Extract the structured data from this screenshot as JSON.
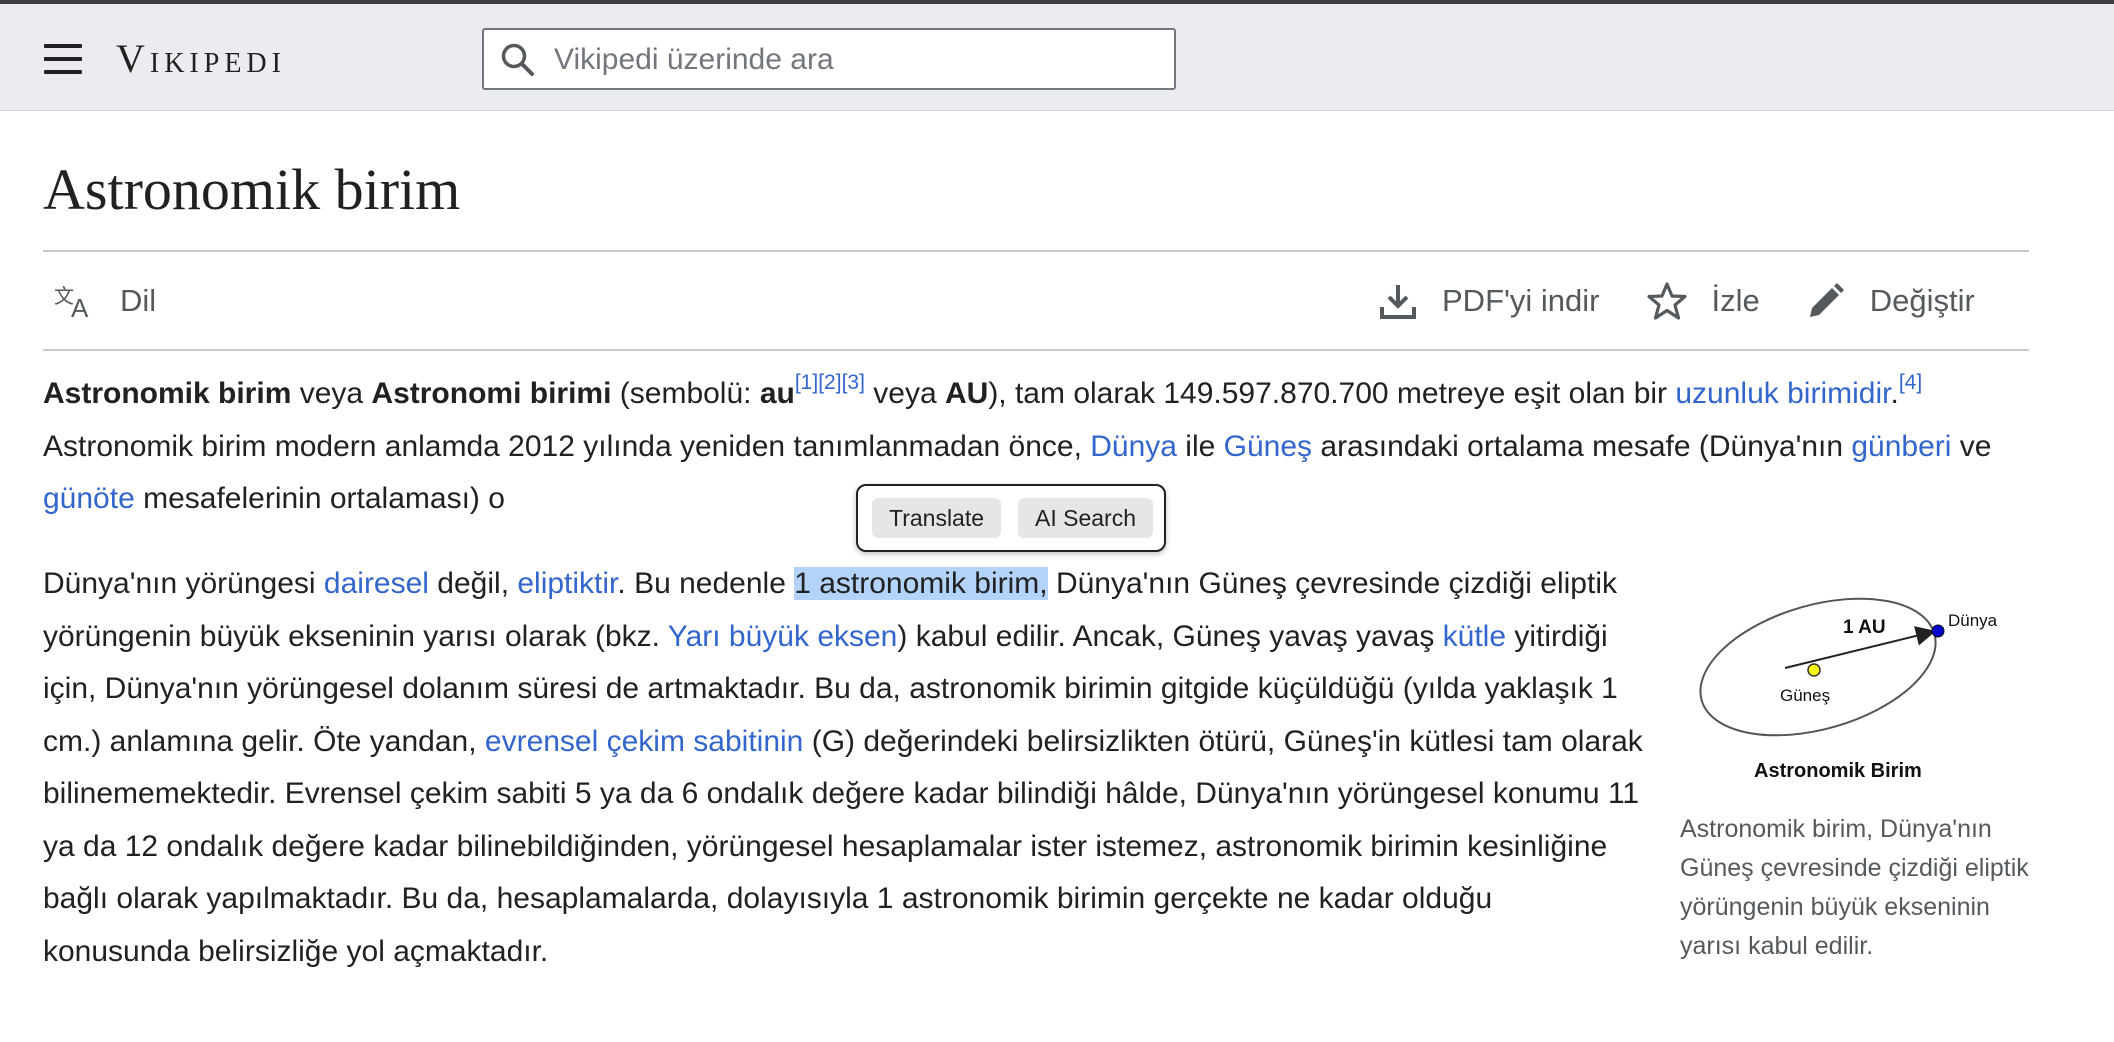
{
  "header": {
    "logo": "Vikipedi",
    "search_placeholder": "Vikipedi üzerinde ara"
  },
  "page": {
    "title": "Astronomik birim"
  },
  "toolbar": {
    "language_label": "Dil",
    "pdf_label": "PDF'yi indir",
    "watch_label": "İzle",
    "edit_label": "Değiştir"
  },
  "para1": {
    "b1": "Astronomik birim",
    "t1": " veya ",
    "b2": "Astronomi birimi",
    "t2": " (sembolü: ",
    "b3": "au",
    "r1": "[1]",
    "r2": "[2]",
    "r3": "[3]",
    "t3": " veya ",
    "b4": "AU",
    "t4": "), tam olarak 149.597.870.700 metreye eşit olan bir ",
    "l1": "uzunluk birimidir",
    "t5": ".",
    "r4": "[4]",
    "t6": " Astronomik birim modern anlamda 2012 yılında yeniden tanımlanmadan önce, ",
    "l2": "Dünya",
    "t7": " ile ",
    "l3": "Güneş",
    "t8": " arasındaki ortalama mesafe (Dünya'nın ",
    "l4": "günberi",
    "t9": " ve ",
    "l5": "günöte",
    "t10": " mesafelerinin ortalaması) o"
  },
  "para2": {
    "t1": "Dünya'nın yörüngesi ",
    "l1": "dairesel",
    "t2": " değil, ",
    "l2": "eliptiktir",
    "t3": ". Bu nedenle ",
    "hl": "1 astronomik birim,",
    "t4": " Dünya'nın Güneş çevresinde çizdiği eliptik yörüngenin büyük ekseninin yarısı olarak (bkz. ",
    "l3": "Yarı büyük eksen",
    "t5": ") kabul edilir. Ancak, Güneş yavaş yavaş ",
    "l4": "kütle",
    "t6": " yitirdiği için, Dünya'nın yörüngesel dolanım süresi de artmaktadır. Bu da, astronomik birimin gitgide küçüldüğü (yılda yaklaşık 1 cm.) anlamına gelir. Öte yandan, ",
    "l5": "evrensel çekim sabitinin",
    "t7": " (G) değerindeki belirsizlikten ötürü, Güneş'in kütlesi tam olarak bilinememektedir. Evrensel çekim sabiti 5 ya da 6 ondalık değere kadar bilindiği hâlde, Dünya'nın yörüngesel konumu 11 ya da 12 ondalık değere kadar bilinebildiğinden, yörüngesel hesaplamalar ister istemez, astronomik birimin kesinliğine bağlı olarak yapılmaktadır. Bu da, hesaplamalarda, dolayısıyla 1 astronomik birimin gerçekte ne kadar olduğu konusunda belirsizliğe yol açmaktadır."
  },
  "selection_popup": {
    "translate": "Translate",
    "ai_search": "AI Search"
  },
  "figure": {
    "label_au": "1 AU",
    "label_earth": "Dünya",
    "label_sun": "Güneş",
    "title": "Astronomik Birim",
    "caption": "Astronomik birim, Dünya'nın Güneş çevresinde çizdiği eliptik yörüngenin büyük ekseninin yarısı kabul edilir.",
    "colors": {
      "sun": "#ffff00",
      "earth": "#0000cc"
    }
  }
}
